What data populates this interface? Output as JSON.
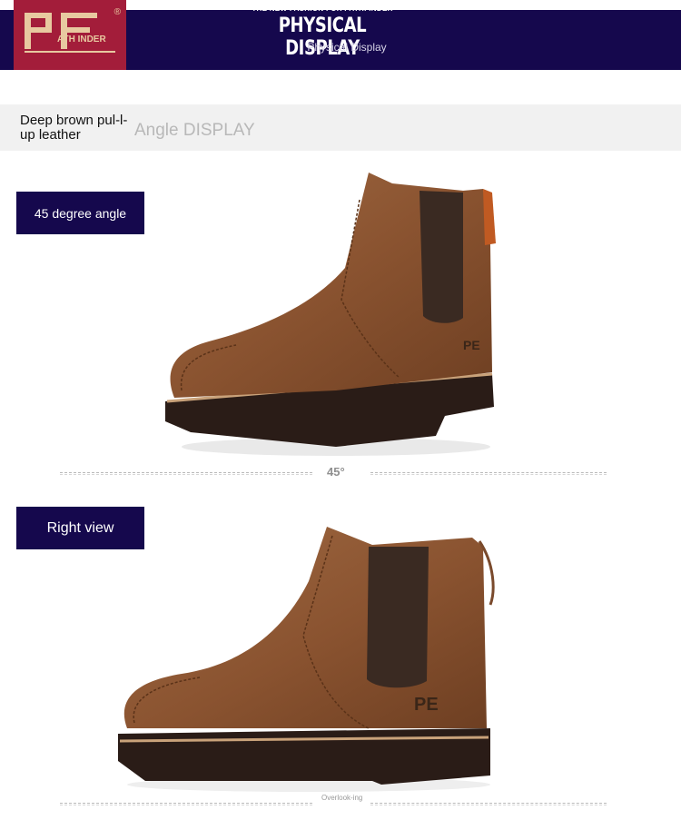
{
  "header": {
    "brand_logo_text": "PATHFINDER",
    "tagline": "THE NEW FASHION FOR PATHFINDER",
    "title": "PHYSICAL DISPLAY",
    "subtitle": "Physical Display"
  },
  "strip": {
    "material": "Deep brown pul-l-up leather",
    "angle_display": "Angle DISPLAY"
  },
  "sections": [
    {
      "label": "45 degree angle",
      "caption": "45°"
    },
    {
      "label": "Right view",
      "caption": "Overlook-ing"
    }
  ],
  "colors": {
    "banner": "#15084d",
    "logo_bg": "#a31d3a",
    "leather": "#8a5330",
    "sole": "#2a1c17"
  }
}
